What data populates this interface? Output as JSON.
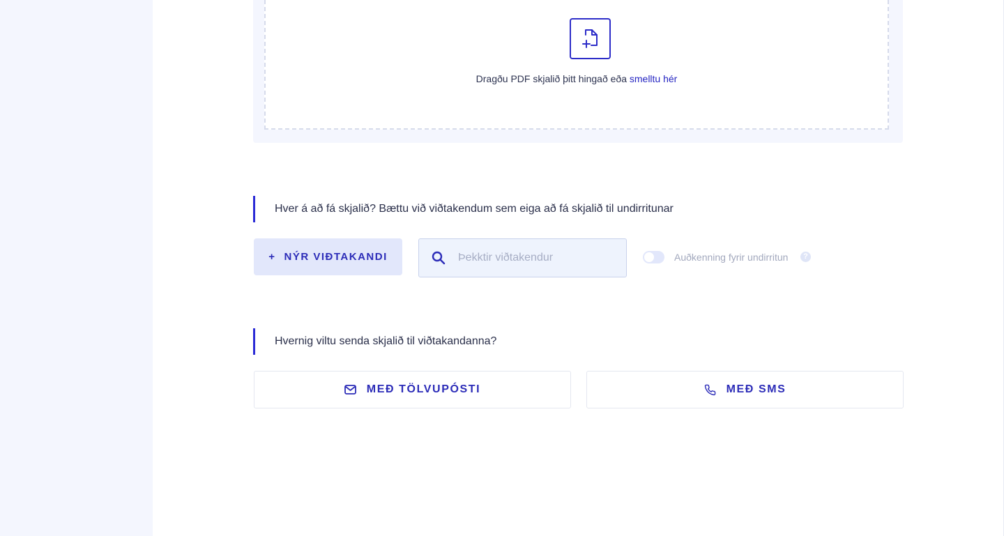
{
  "upload": {
    "text": "Dragðu PDF skjalið þitt hingað eða ",
    "link_text": "smelltu hér",
    "icon": "file-plus-icon"
  },
  "recipients_section": {
    "title": "Hver á að fá skjalið? Bættu við viðtakendum sem eiga að fá skjalið til undirritunar",
    "new_recipient_button": "NÝR VIÐTAKANDI",
    "new_recipient_icon": "+",
    "search_placeholder": "Þekktir viðtakendur",
    "search_icon": "search-icon",
    "toggle_label": "Auðkenning fyrir undirritun",
    "toggle_on": false,
    "help_icon": "?"
  },
  "send_section": {
    "title": "Hvernig viltu senda skjalið til viðtakandanna?",
    "email_button": "MEÐ TÖLVUPÓSTI",
    "email_icon": "mail-icon",
    "sms_button": "MEÐ SMS",
    "sms_icon": "phone-icon"
  },
  "colors": {
    "accent": "#2b2bd6",
    "sidebar_bg": "#f4f6fe",
    "button_bg": "#e2e7fb"
  }
}
